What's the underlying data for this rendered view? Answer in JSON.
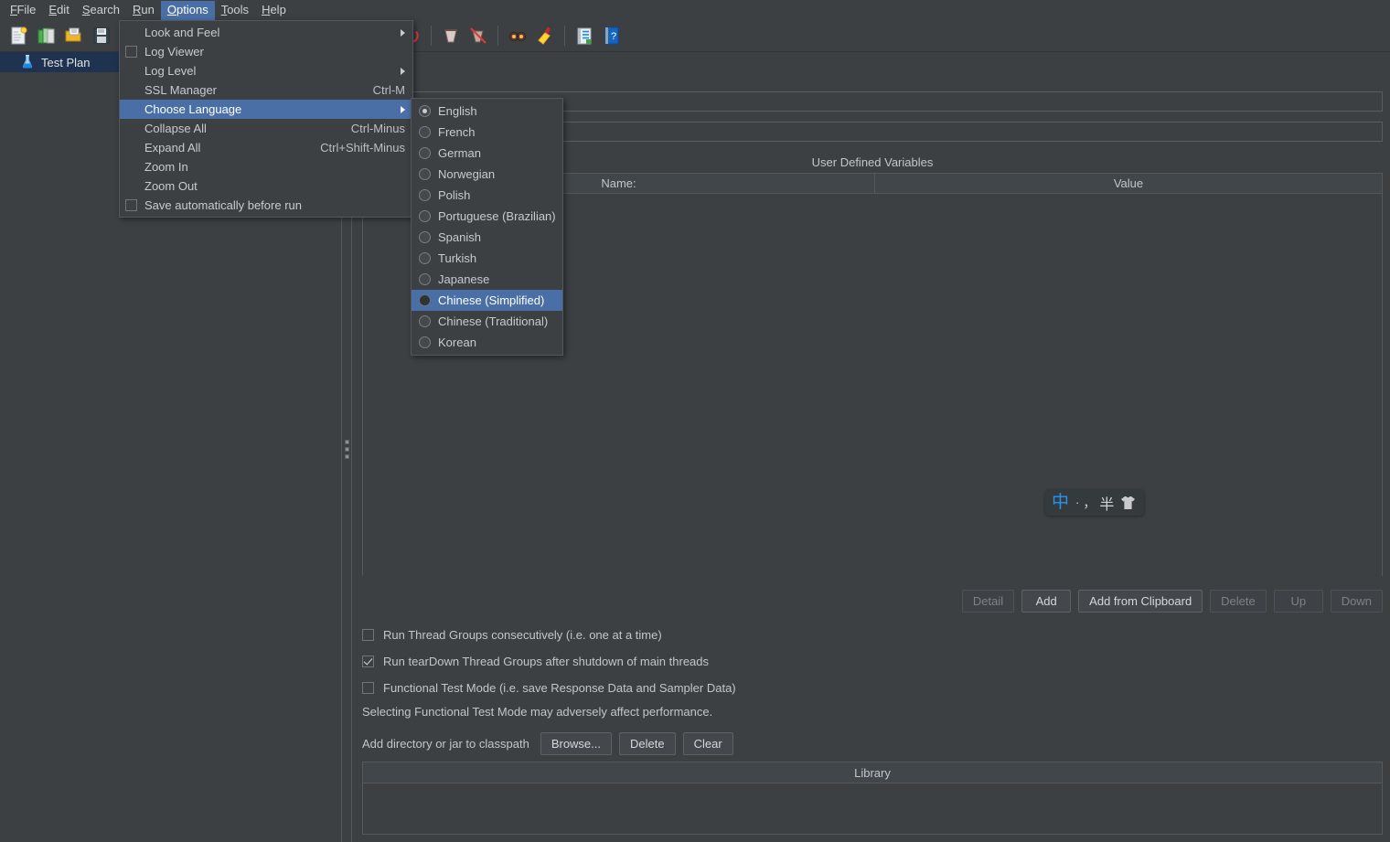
{
  "menubar": {
    "items": [
      {
        "label": "File",
        "mnemonic": "F"
      },
      {
        "label": "Edit",
        "mnemonic": "E"
      },
      {
        "label": "Search",
        "mnemonic": "S"
      },
      {
        "label": "Run",
        "mnemonic": "R"
      },
      {
        "label": "Options",
        "mnemonic": "O"
      },
      {
        "label": "Tools",
        "mnemonic": "T"
      },
      {
        "label": "Help",
        "mnemonic": "H"
      }
    ],
    "active": "Options"
  },
  "toolbar": {
    "icons": [
      "new-test-plan-icon",
      "templates-icon",
      "open-icon",
      "save-icon",
      "cut-icon",
      "copy-icon",
      "paste-icon",
      "expand-icon",
      "collapse-icon",
      "toggle-icon",
      "start-icon",
      "start-no-pauses-icon",
      "stop-icon",
      "shutdown-icon",
      "clear-icon",
      "clear-all-icon",
      "search-icon",
      "reset-search-icon",
      "function-helper-icon",
      "help-icon"
    ]
  },
  "tree": {
    "items": [
      {
        "label": "Test Plan",
        "icon": "test-plan-flask-icon",
        "selected": true
      }
    ]
  },
  "options_menu": {
    "items": [
      {
        "label": "Look and Feel",
        "mnemonic": "L",
        "type": "submenu",
        "accel": "",
        "highlight": false
      },
      {
        "label": "Log Viewer",
        "mnemonic": "",
        "type": "checkbox",
        "accel": "",
        "checked": false,
        "highlight": false
      },
      {
        "label": "Log Level",
        "mnemonic": "",
        "type": "submenu",
        "accel": "",
        "highlight": false
      },
      {
        "label": "SSL Manager",
        "mnemonic": "S",
        "type": "item",
        "accel": "Ctrl-M",
        "highlight": false
      },
      {
        "label": "Choose Language",
        "mnemonic": "C",
        "type": "submenu",
        "accel": "",
        "highlight": true
      },
      {
        "label": "Collapse All",
        "mnemonic": "",
        "type": "item",
        "accel": "Ctrl-Minus",
        "highlight": false
      },
      {
        "label": "Expand All",
        "mnemonic": "x",
        "type": "item",
        "accel": "Ctrl+Shift-Minus",
        "highlight": false
      },
      {
        "label": "Zoom In",
        "mnemonic": "I",
        "type": "item",
        "accel": "",
        "highlight": false
      },
      {
        "label": "Zoom Out",
        "mnemonic": "u",
        "type": "item",
        "accel": "",
        "highlight": false
      },
      {
        "label": "Save automatically before run",
        "mnemonic": "",
        "type": "checkbox",
        "accel": "",
        "checked": false,
        "highlight": false
      }
    ]
  },
  "language_menu": {
    "items": [
      {
        "label": "English",
        "selected": true,
        "highlight": false
      },
      {
        "label": "French",
        "selected": false,
        "highlight": false
      },
      {
        "label": "German",
        "selected": false,
        "highlight": false
      },
      {
        "label": "Norwegian",
        "selected": false,
        "highlight": false
      },
      {
        "label": "Polish",
        "selected": false,
        "highlight": false
      },
      {
        "label": "Portuguese (Brazilian)",
        "selected": false,
        "highlight": false
      },
      {
        "label": "Spanish",
        "selected": false,
        "highlight": false
      },
      {
        "label": "Turkish",
        "selected": false,
        "highlight": false
      },
      {
        "label": "Japanese",
        "selected": false,
        "highlight": false
      },
      {
        "label": "Chinese (Simplified)",
        "selected": false,
        "highlight": true
      },
      {
        "label": "Chinese (Traditional)",
        "selected": false,
        "highlight": false
      },
      {
        "label": "Korean",
        "selected": false,
        "highlight": false
      }
    ]
  },
  "testplan": {
    "name_value": "",
    "name_placeholder": "",
    "comments_value": "",
    "comments_placeholder": "",
    "udv_title": "User Defined Variables",
    "udv_columns": [
      "Name:",
      "Value"
    ],
    "udv_rows": [],
    "table_buttons": [
      {
        "label": "Detail",
        "enabled": false
      },
      {
        "label": "Add",
        "enabled": true
      },
      {
        "label": "Add from Clipboard",
        "enabled": true
      },
      {
        "label": "Delete",
        "enabled": false
      },
      {
        "label": "Up",
        "enabled": false
      },
      {
        "label": "Down",
        "enabled": false
      }
    ],
    "options": [
      {
        "label": "Run Thread Groups consecutively (i.e. one at a time)",
        "checked": false
      },
      {
        "label": "Run tearDown Thread Groups after shutdown of main threads",
        "checked": true
      },
      {
        "label": "Functional Test Mode (i.e. save Response Data and Sampler Data)",
        "checked": false
      }
    ],
    "note": "Selecting Functional Test Mode may adversely affect performance.",
    "classpath_label": "Add directory or jar to classpath",
    "classpath_buttons": [
      {
        "label": "Browse...",
        "enabled": true
      },
      {
        "label": "Delete",
        "enabled": true
      },
      {
        "label": "Clear",
        "enabled": true
      }
    ],
    "library_column": "Library",
    "library_rows": []
  },
  "ime": {
    "mode": "中",
    "dot": "·",
    "comma": "，",
    "width": "半",
    "shirt_icon": "shirt-icon"
  },
  "colors": {
    "background": "#3c4043",
    "highlight": "#4a6fa7",
    "tree_selected": "#1f3250",
    "text": "#c3c6c9",
    "border": "#55585c",
    "ime_accent": "#2196f3"
  }
}
